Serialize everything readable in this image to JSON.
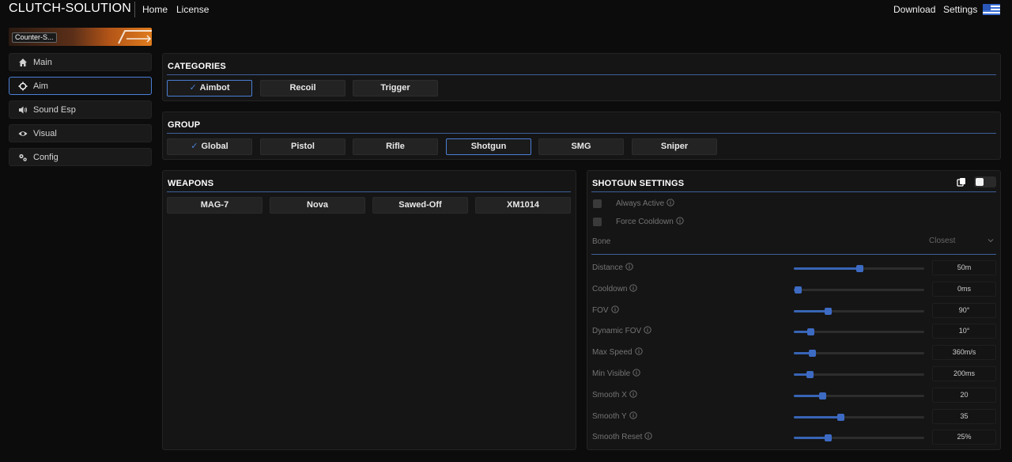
{
  "app": {
    "brand": "CLUTCH-SOLUTION",
    "nav_left": [
      "Home",
      "License"
    ],
    "nav_right": [
      "Download",
      "Settings"
    ],
    "flag_icon": "us-flag-icon",
    "accent": "#4a7fd6"
  },
  "sidebar": {
    "game_banner_label": "Counter-S...",
    "items": [
      {
        "label": "Main",
        "icon": "home-icon",
        "active": false
      },
      {
        "label": "Aim",
        "icon": "crosshair-icon",
        "active": true
      },
      {
        "label": "Sound Esp",
        "icon": "speaker-icon",
        "active": false
      },
      {
        "label": "Visual",
        "icon": "eye-icon",
        "active": false
      },
      {
        "label": "Config",
        "icon": "gears-icon",
        "active": false
      }
    ]
  },
  "categories": {
    "title": "CATEGORIES",
    "tabs": [
      {
        "label": "Aimbot",
        "active": true
      },
      {
        "label": "Recoil",
        "active": false
      },
      {
        "label": "Trigger",
        "active": false
      }
    ]
  },
  "group": {
    "title": "GROUP",
    "tabs": [
      {
        "label": "Global",
        "active": false,
        "checked": true
      },
      {
        "label": "Pistol",
        "active": false
      },
      {
        "label": "Rifle",
        "active": false
      },
      {
        "label": "Shotgun",
        "active": true
      },
      {
        "label": "SMG",
        "active": false
      },
      {
        "label": "Sniper",
        "active": false
      }
    ]
  },
  "weapons": {
    "title": "WEAPONS",
    "items": [
      "MAG-7",
      "Nova",
      "Sawed-Off",
      "XM1014"
    ]
  },
  "settings": {
    "title": "SHOTGUN SETTINGS",
    "enabled": false,
    "checkboxes": [
      {
        "label": "Always Active",
        "checked": false
      },
      {
        "label": "Force Cooldown",
        "checked": false
      }
    ],
    "bone": {
      "label": "Bone",
      "value": "Closest"
    },
    "sliders": [
      {
        "label": "Distance",
        "value": "50m",
        "fraction": 0.5
      },
      {
        "label": "Cooldown",
        "value": "0ms",
        "fraction": 0.03
      },
      {
        "label": "FOV",
        "value": "90°",
        "fraction": 0.26
      },
      {
        "label": "Dynamic FOV",
        "value": "10°",
        "fraction": 0.13
      },
      {
        "label": "Max Speed",
        "value": "360m/s",
        "fraction": 0.14
      },
      {
        "label": "Min Visible",
        "value": "200ms",
        "fraction": 0.12
      },
      {
        "label": "Smooth X",
        "value": "20",
        "fraction": 0.22
      },
      {
        "label": "Smooth Y",
        "value": "35",
        "fraction": 0.36
      },
      {
        "label": "Smooth Reset",
        "value": "25%",
        "fraction": 0.26
      }
    ]
  }
}
